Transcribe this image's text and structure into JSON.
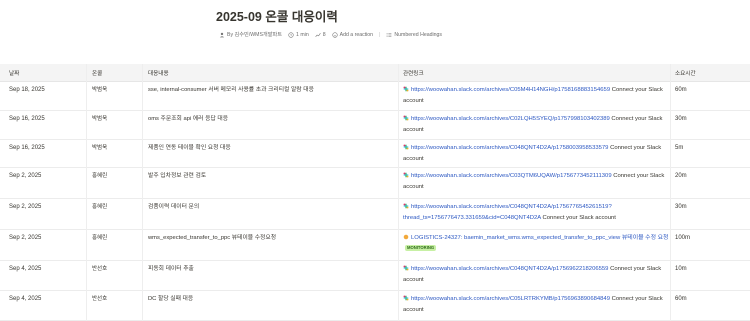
{
  "page": {
    "title": "2025-09 온콜 대응이력",
    "meta": {
      "author": "By 김수민/WMS개발파트",
      "read_time": "1 min",
      "views": "8",
      "add_reaction": "Add a reaction",
      "numbered_headings": "Numbered Headings"
    }
  },
  "table": {
    "headers": [
      "날짜",
      "온콜",
      "대응내용",
      "관련링크",
      "소요시간"
    ],
    "rows": [
      {
        "date": "Sep 18, 2025",
        "owner": "박범욱",
        "task": "sse, internal-consumer 서버 메모리 사용률 초과 크리티컬 알람 대응",
        "link": "https://woowahan.slack.com/archives/C05M4H14NGH/p1758168883154659",
        "link_suffix": "Connect your Slack account",
        "time": "60m"
      },
      {
        "date": "Sep 16, 2025",
        "owner": "박범욱",
        "task": "oms 주문조회 api 에러 응답 대응",
        "link": "https://woowahan.slack.com/archives/C02LQH5SYEQ/p1757998103402389",
        "link_suffix": "Connect your Slack account",
        "time": "30m"
      },
      {
        "date": "Sep 16, 2025",
        "owner": "박범욱",
        "task": "제품인 연동 테이블 확인 요청 대응",
        "link": "https://woowahan.slack.com/archives/C048QNT4D2A/p1758003958533579",
        "link_suffix": "Connect your Slack account",
        "time": "5m"
      },
      {
        "date": "Sep 2, 2025",
        "owner": "홍혜린",
        "task": "발주 입차정보 관련 검토",
        "link": "https://woowahan.slack.com/archives/C03QTM6UQAW/p1756773452111309",
        "link_suffix": "Connect your Slack account",
        "time": "20m"
      },
      {
        "date": "Sep 2, 2025",
        "owner": "홍혜린",
        "task": "검품이력 데이터 문의",
        "link": "https://woowahan.slack.com/archives/C048QNT4D2A/p1756776545261519?thread_ts=1756776473.331659&cid=C048QNT4D2A",
        "link_suffix": "Connect your Slack account",
        "time": "30m"
      },
      {
        "date": "Sep 2, 2025",
        "owner": "홍혜린",
        "task": "wms_expected_transfer_to_ppc 뷰테이블 수정요청",
        "link": "LOGISTICS-24327: baemin_market_wms.wms_expected_transfer_to_ppc_view 뷰테이블 수정 요청",
        "link_suffix": "",
        "badge": "MONITORING",
        "time": "100m"
      },
      {
        "date": "Sep 4, 2025",
        "owner": "반선호",
        "task": "피동회 데이터 추출",
        "link": "https://woowahan.slack.com/archives/C048QNT4D2A/p1756962218206559",
        "link_suffix": "Connect your Slack account",
        "time": "10m"
      },
      {
        "date": "Sep 4, 2025",
        "owner": "반선호",
        "task": "DC 할당 실패 대응",
        "link": "https://woowahan.slack.com/archives/C05LRTRKYMB/p1756963890684849",
        "link_suffix": "Connect your Slack account",
        "time": "60m"
      }
    ]
  }
}
